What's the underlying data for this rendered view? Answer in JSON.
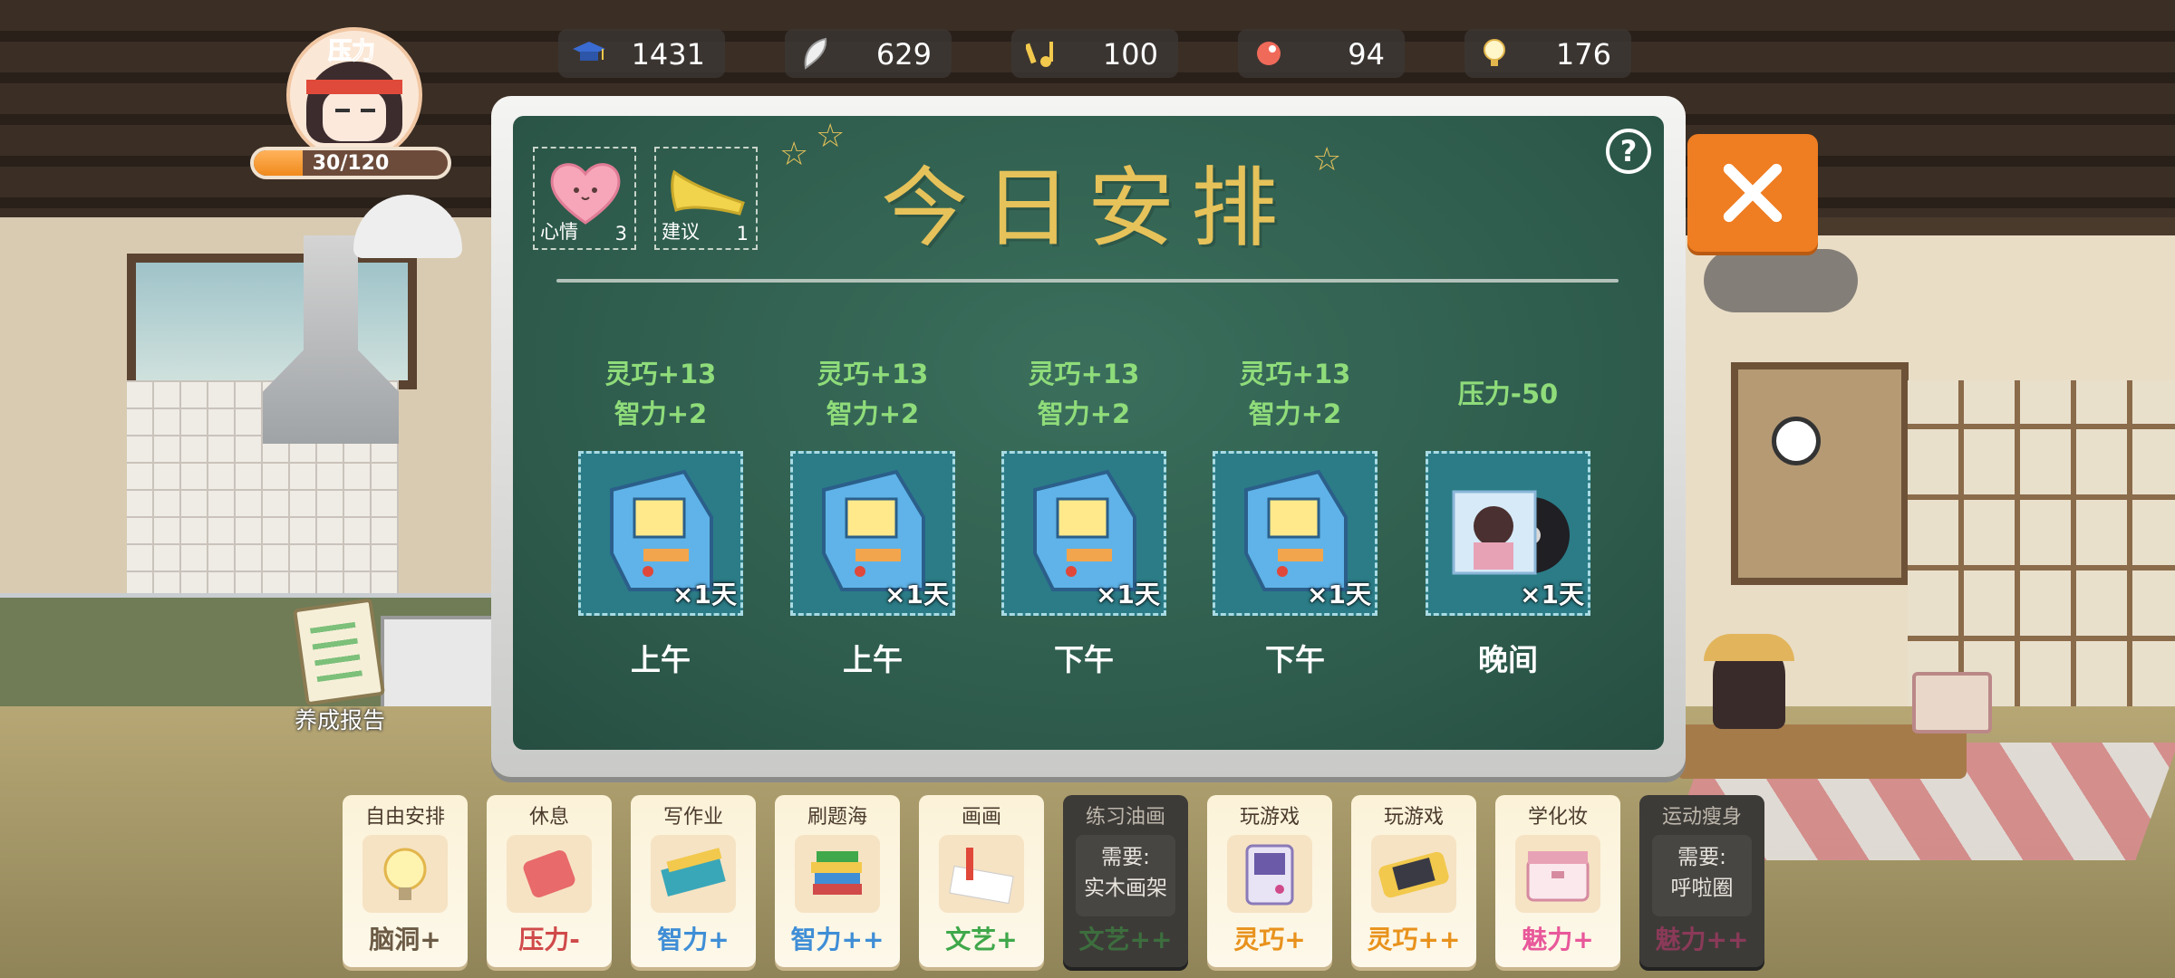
{
  "player": {
    "stress_label": "压力",
    "stress_text": "30/120",
    "stress_fraction": 0.25
  },
  "stats": [
    {
      "icon": "graduation-cap-icon",
      "value": "1431"
    },
    {
      "icon": "feather-icon",
      "value": "629"
    },
    {
      "icon": "music-note-icon",
      "value": "100"
    },
    {
      "icon": "flower-icon",
      "value": "94"
    },
    {
      "icon": "lightbulb-icon",
      "value": "176"
    }
  ],
  "board": {
    "title": "今日安排",
    "mood": {
      "label": "心情",
      "count": "3"
    },
    "advice": {
      "label": "建议",
      "count": "1"
    },
    "help": "?",
    "slots": [
      {
        "effect1": "灵巧+13",
        "effect2": "智力+2",
        "duration": "×1天",
        "time": "上午",
        "item": "arcade-machine"
      },
      {
        "effect1": "灵巧+13",
        "effect2": "智力+2",
        "duration": "×1天",
        "time": "上午",
        "item": "arcade-machine"
      },
      {
        "effect1": "灵巧+13",
        "effect2": "智力+2",
        "duration": "×1天",
        "time": "下午",
        "item": "arcade-machine"
      },
      {
        "effect1": "灵巧+13",
        "effect2": "智力+2",
        "duration": "×1天",
        "time": "下午",
        "item": "arcade-machine"
      },
      {
        "effect1": "压力-50",
        "effect2": "",
        "duration": "×1天",
        "time": "晚间",
        "item": "music-record"
      }
    ]
  },
  "report": {
    "label": "养成报告"
  },
  "activities": [
    {
      "name": "自由安排",
      "bonus": "脑洞+",
      "color": "#6b5a44",
      "locked": false
    },
    {
      "name": "休息",
      "bonus": "压力-",
      "color": "#d04a4a",
      "locked": false
    },
    {
      "name": "写作业",
      "bonus": "智力+",
      "color": "#3f8ed6",
      "locked": false
    },
    {
      "name": "刷题海",
      "bonus": "智力++",
      "color": "#3f8ed6",
      "locked": false
    },
    {
      "name": "画画",
      "bonus": "文艺+",
      "color": "#3fa84a",
      "locked": false
    },
    {
      "name": "练习油画",
      "need1": "需要:",
      "need2": "实木画架",
      "bonus": "文艺++",
      "color": "#3d6e3e",
      "locked": true
    },
    {
      "name": "玩游戏",
      "bonus": "灵巧+",
      "color": "#e8921c",
      "locked": false
    },
    {
      "name": "玩游戏",
      "bonus": "灵巧++",
      "color": "#e8921c",
      "locked": false
    },
    {
      "name": "学化妆",
      "bonus": "魅力+",
      "color": "#e8589a",
      "locked": false
    },
    {
      "name": "运动瘦身",
      "need1": "需要:",
      "need2": "呼啦圈",
      "bonus": "魅力++",
      "color": "#8a3a58",
      "locked": true
    }
  ]
}
